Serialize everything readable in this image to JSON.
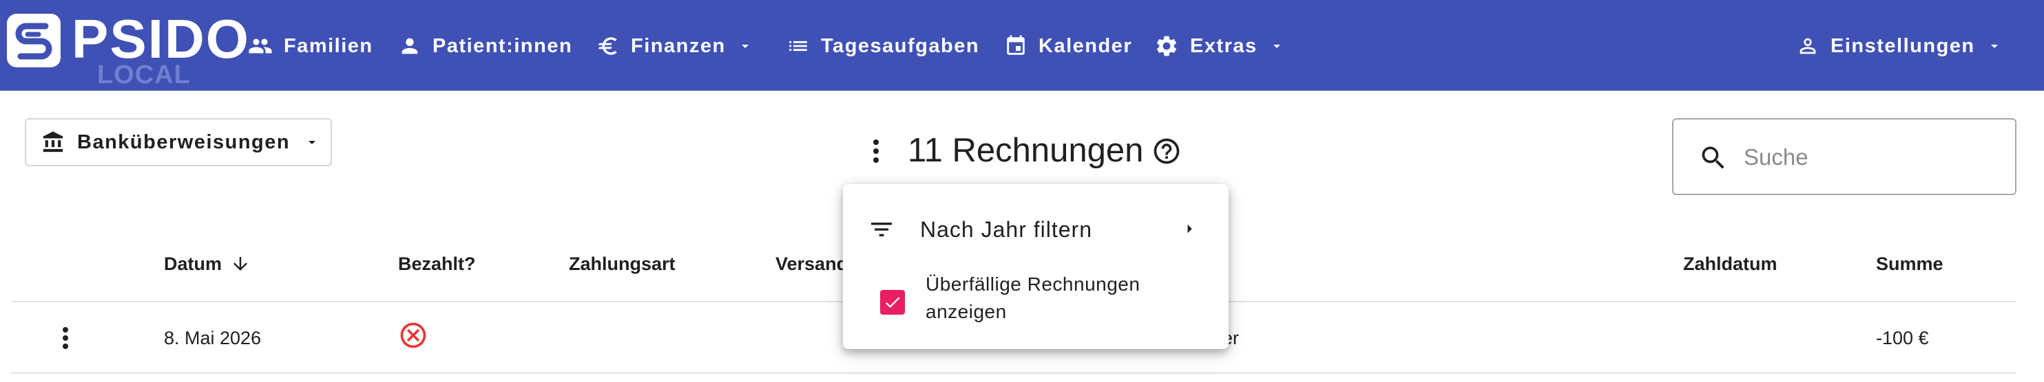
{
  "app": {
    "logo_text": "PSIDO",
    "logo_sub": "LOCAL"
  },
  "nav": {
    "familien": "Familien",
    "patienten": "Patient:innen",
    "finanzen": "Finanzen",
    "tagesaufgaben": "Tagesaufgaben",
    "kalender": "Kalender",
    "extras": "Extras",
    "einstellungen": "Einstellungen"
  },
  "toolbar": {
    "bank_transfers_label": "Banküberweisungen",
    "title": "11 Rechnungen"
  },
  "search": {
    "placeholder": "Suche",
    "value": ""
  },
  "table": {
    "columns": {
      "datum": "Datum",
      "bezahlt": "Bezahlt?",
      "zahlungsart": "Zahlungsart",
      "versand": "Versand",
      "zahldatum": "Zahldatum",
      "summe": "Summe"
    },
    "rows": [
      {
        "datum": "8. Mai 2026",
        "bezahlt": false,
        "partial_text": "ner",
        "summe": "-100 €"
      }
    ]
  },
  "menu": {
    "filter_by_year": "Nach Jahr filtern",
    "show_overdue": "Überfällige Rechnungen anzeigen",
    "show_overdue_checked": true
  },
  "icons": {
    "familien": "group-icon",
    "patienten": "person-icon",
    "finanzen": "euro-icon",
    "tagesaufgaben": "list-icon",
    "kalender": "calendar-icon",
    "extras": "gear-icon",
    "einstellungen": "person-outline-icon",
    "bank": "bank-icon",
    "search": "search-icon",
    "help": "help-circle-icon",
    "filter": "filter-icon",
    "unpaid": "cancel-circle-icon"
  },
  "colors": {
    "appbar": "#3f51b5",
    "accent_checkbox": "#e91e63",
    "error": "#e53935"
  }
}
